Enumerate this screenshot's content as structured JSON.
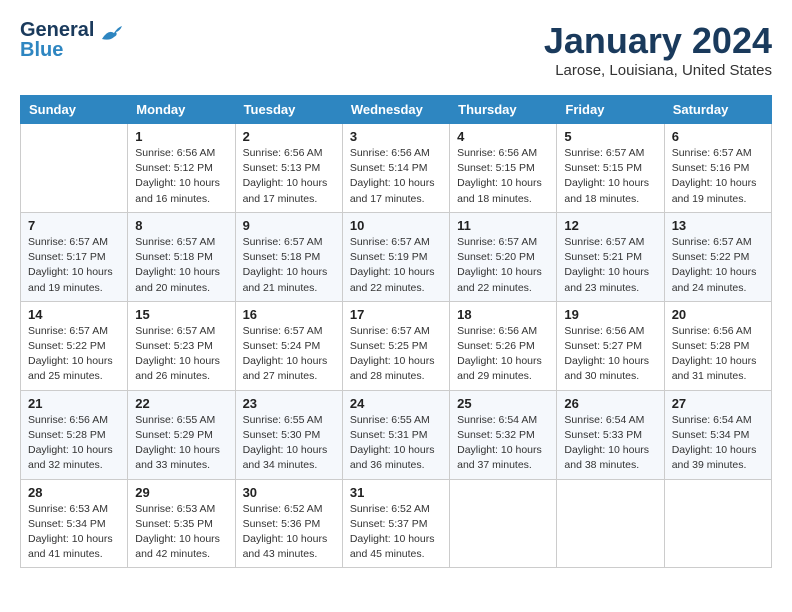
{
  "header": {
    "logo_line1": "General",
    "logo_line2": "Blue",
    "month": "January 2024",
    "location": "Larose, Louisiana, United States"
  },
  "days_of_week": [
    "Sunday",
    "Monday",
    "Tuesday",
    "Wednesday",
    "Thursday",
    "Friday",
    "Saturday"
  ],
  "weeks": [
    [
      {
        "num": "",
        "info": ""
      },
      {
        "num": "1",
        "info": "Sunrise: 6:56 AM\nSunset: 5:12 PM\nDaylight: 10 hours\nand 16 minutes."
      },
      {
        "num": "2",
        "info": "Sunrise: 6:56 AM\nSunset: 5:13 PM\nDaylight: 10 hours\nand 17 minutes."
      },
      {
        "num": "3",
        "info": "Sunrise: 6:56 AM\nSunset: 5:14 PM\nDaylight: 10 hours\nand 17 minutes."
      },
      {
        "num": "4",
        "info": "Sunrise: 6:56 AM\nSunset: 5:15 PM\nDaylight: 10 hours\nand 18 minutes."
      },
      {
        "num": "5",
        "info": "Sunrise: 6:57 AM\nSunset: 5:15 PM\nDaylight: 10 hours\nand 18 minutes."
      },
      {
        "num": "6",
        "info": "Sunrise: 6:57 AM\nSunset: 5:16 PM\nDaylight: 10 hours\nand 19 minutes."
      }
    ],
    [
      {
        "num": "7",
        "info": "Sunrise: 6:57 AM\nSunset: 5:17 PM\nDaylight: 10 hours\nand 19 minutes."
      },
      {
        "num": "8",
        "info": "Sunrise: 6:57 AM\nSunset: 5:18 PM\nDaylight: 10 hours\nand 20 minutes."
      },
      {
        "num": "9",
        "info": "Sunrise: 6:57 AM\nSunset: 5:18 PM\nDaylight: 10 hours\nand 21 minutes."
      },
      {
        "num": "10",
        "info": "Sunrise: 6:57 AM\nSunset: 5:19 PM\nDaylight: 10 hours\nand 22 minutes."
      },
      {
        "num": "11",
        "info": "Sunrise: 6:57 AM\nSunset: 5:20 PM\nDaylight: 10 hours\nand 22 minutes."
      },
      {
        "num": "12",
        "info": "Sunrise: 6:57 AM\nSunset: 5:21 PM\nDaylight: 10 hours\nand 23 minutes."
      },
      {
        "num": "13",
        "info": "Sunrise: 6:57 AM\nSunset: 5:22 PM\nDaylight: 10 hours\nand 24 minutes."
      }
    ],
    [
      {
        "num": "14",
        "info": "Sunrise: 6:57 AM\nSunset: 5:22 PM\nDaylight: 10 hours\nand 25 minutes."
      },
      {
        "num": "15",
        "info": "Sunrise: 6:57 AM\nSunset: 5:23 PM\nDaylight: 10 hours\nand 26 minutes."
      },
      {
        "num": "16",
        "info": "Sunrise: 6:57 AM\nSunset: 5:24 PM\nDaylight: 10 hours\nand 27 minutes."
      },
      {
        "num": "17",
        "info": "Sunrise: 6:57 AM\nSunset: 5:25 PM\nDaylight: 10 hours\nand 28 minutes."
      },
      {
        "num": "18",
        "info": "Sunrise: 6:56 AM\nSunset: 5:26 PM\nDaylight: 10 hours\nand 29 minutes."
      },
      {
        "num": "19",
        "info": "Sunrise: 6:56 AM\nSunset: 5:27 PM\nDaylight: 10 hours\nand 30 minutes."
      },
      {
        "num": "20",
        "info": "Sunrise: 6:56 AM\nSunset: 5:28 PM\nDaylight: 10 hours\nand 31 minutes."
      }
    ],
    [
      {
        "num": "21",
        "info": "Sunrise: 6:56 AM\nSunset: 5:28 PM\nDaylight: 10 hours\nand 32 minutes."
      },
      {
        "num": "22",
        "info": "Sunrise: 6:55 AM\nSunset: 5:29 PM\nDaylight: 10 hours\nand 33 minutes."
      },
      {
        "num": "23",
        "info": "Sunrise: 6:55 AM\nSunset: 5:30 PM\nDaylight: 10 hours\nand 34 minutes."
      },
      {
        "num": "24",
        "info": "Sunrise: 6:55 AM\nSunset: 5:31 PM\nDaylight: 10 hours\nand 36 minutes."
      },
      {
        "num": "25",
        "info": "Sunrise: 6:54 AM\nSunset: 5:32 PM\nDaylight: 10 hours\nand 37 minutes."
      },
      {
        "num": "26",
        "info": "Sunrise: 6:54 AM\nSunset: 5:33 PM\nDaylight: 10 hours\nand 38 minutes."
      },
      {
        "num": "27",
        "info": "Sunrise: 6:54 AM\nSunset: 5:34 PM\nDaylight: 10 hours\nand 39 minutes."
      }
    ],
    [
      {
        "num": "28",
        "info": "Sunrise: 6:53 AM\nSunset: 5:34 PM\nDaylight: 10 hours\nand 41 minutes."
      },
      {
        "num": "29",
        "info": "Sunrise: 6:53 AM\nSunset: 5:35 PM\nDaylight: 10 hours\nand 42 minutes."
      },
      {
        "num": "30",
        "info": "Sunrise: 6:52 AM\nSunset: 5:36 PM\nDaylight: 10 hours\nand 43 minutes."
      },
      {
        "num": "31",
        "info": "Sunrise: 6:52 AM\nSunset: 5:37 PM\nDaylight: 10 hours\nand 45 minutes."
      },
      {
        "num": "",
        "info": ""
      },
      {
        "num": "",
        "info": ""
      },
      {
        "num": "",
        "info": ""
      }
    ]
  ]
}
